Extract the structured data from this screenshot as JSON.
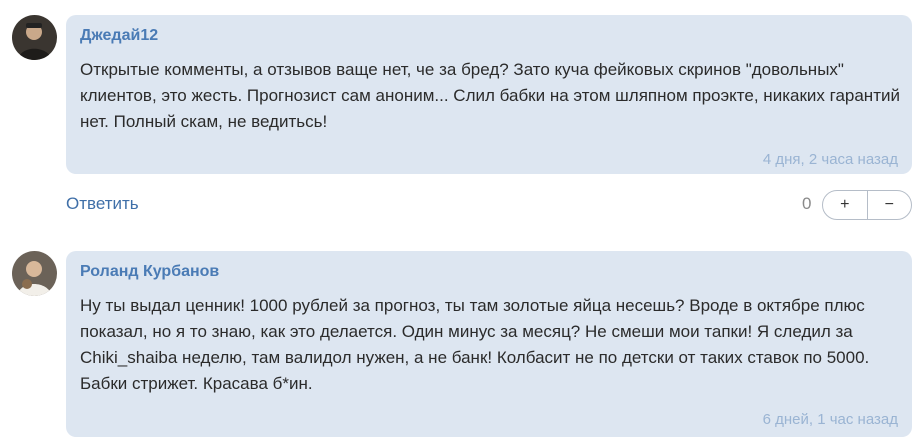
{
  "comments": [
    {
      "author": "Джедай12",
      "avatar_icon": "user-photo-avatar",
      "text": "Открытые комменты, а отзывов ваще нет, че за бред? Зато куча фейковых скринов \"довольных\" клиентов, это жесть. Прогнозист сам аноним... Слил бабки на этом шляпном проэкте, никаких гарантий нет. Полный скам, не ведитьсь!",
      "time": "4 дня, 2 часа назад"
    },
    {
      "author": "Роланд Курбанов",
      "avatar_icon": "user-photo-avatar",
      "text": "Ну ты выдал ценник! 1000 рублей за прогноз, ты там золотые яйца несешь? Вроде в октябре плюс показал, но я то знаю, как это делается. Один минус за месяц? Не смеши мои тапки! Я следил за Chiki_shaiba неделю, там валидол нужен, а не банк! Колбасит не по детски от таких ставок по 5000. Бабки стрижет. Красава б*ин.",
      "time": "6 дней, 1 час назад"
    }
  ],
  "actions": {
    "reply_label": "Ответить",
    "score": "0",
    "plus_label": "+",
    "minus_label": "−"
  },
  "colors": {
    "bubble": "#dde6f1",
    "author": "#4a7bb5",
    "link": "#3f6fa8",
    "time": "#9ab4d3"
  }
}
